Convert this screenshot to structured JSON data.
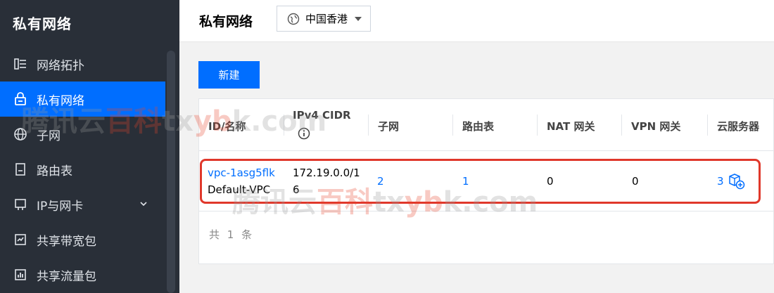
{
  "sidebar": {
    "title": "私有网络",
    "items": [
      {
        "label": "网络拓扑",
        "icon": "topology-icon"
      },
      {
        "label": "私有网络",
        "icon": "lock-icon",
        "active": true
      },
      {
        "label": "子网",
        "icon": "globe-icon"
      },
      {
        "label": "路由表",
        "icon": "document-icon"
      },
      {
        "label": "IP与网卡",
        "icon": "network-card-icon",
        "expandable": true
      },
      {
        "label": "共享带宽包",
        "icon": "bandwidth-package-icon"
      },
      {
        "label": "共享流量包",
        "icon": "traffic-package-icon"
      }
    ]
  },
  "header": {
    "title": "私有网络",
    "region": "中国香港"
  },
  "toolbar": {
    "create_label": "新建"
  },
  "table": {
    "columns": [
      "ID/名称",
      "IPv4 CIDR",
      "子网",
      "路由表",
      "NAT 网关",
      "VPN 网关",
      "云服务器"
    ],
    "rows": [
      {
        "id": "vpc-1asg5flk",
        "name": "Default-VPC",
        "cidr_line1": "172.19.0.0/1",
        "cidr_line2": "6",
        "subnets": "2",
        "route_tables": "1",
        "nat_gateways": "0",
        "vpn_gateways": "0",
        "cvm_count": "3"
      }
    ],
    "footer": "共 1 条"
  },
  "watermark": {
    "gray_text": "腾讯云",
    "red_text": "百科",
    "suffix_gray": "tx",
    "suffix_red": "yb",
    "suffix_gray2": "k.com"
  },
  "colors": {
    "sidebar_bg": "#292f38",
    "accent": "#006eff",
    "highlight": "#e0382b"
  }
}
